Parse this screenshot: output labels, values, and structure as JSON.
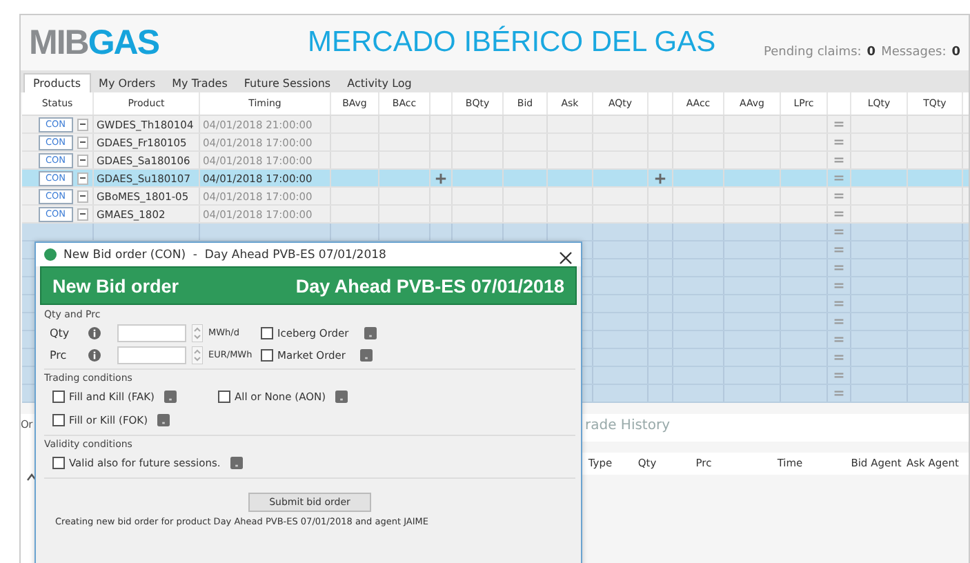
{
  "header": {
    "logo_left": "MIB",
    "logo_right": "GAS",
    "title": "MERCADO IBÉRICO DEL GAS",
    "pending_label": "Pending claims:",
    "pending_count": "0",
    "messages_label": "Messages:",
    "messages_count": "0"
  },
  "tabs": [
    {
      "label": "Products",
      "selected": true
    },
    {
      "label": "My Orders",
      "selected": false
    },
    {
      "label": "My Trades",
      "selected": false
    },
    {
      "label": "Future Sessions",
      "selected": false
    },
    {
      "label": "Activity Log",
      "selected": false
    }
  ],
  "table": {
    "columns": [
      {
        "kind": "text",
        "label": "Status"
      },
      {
        "kind": "text",
        "label": "Product"
      },
      {
        "kind": "text",
        "label": "Timing"
      },
      {
        "kind": "text",
        "label": "BAvg"
      },
      {
        "kind": "text",
        "label": "BAcc"
      },
      {
        "kind": "action"
      },
      {
        "kind": "text",
        "label": "BQty"
      },
      {
        "kind": "text",
        "label": "Bid"
      },
      {
        "kind": "text",
        "label": "Ask"
      },
      {
        "kind": "text",
        "label": "AQty"
      },
      {
        "kind": "action"
      },
      {
        "kind": "text",
        "label": "AAcc"
      },
      {
        "kind": "text",
        "label": "AAvg"
      },
      {
        "kind": "text",
        "label": "LPrc"
      },
      {
        "kind": "marker"
      },
      {
        "kind": "text",
        "label": "LQty"
      },
      {
        "kind": "text",
        "label": "TQty"
      }
    ],
    "rows": [
      {
        "kind": "product",
        "status": "CON",
        "product": "GWDES_Th180104",
        "timing": "04/01/2018 21:00:00",
        "selected": false
      },
      {
        "kind": "product",
        "status": "CON",
        "product": "GDAES_Fr180105",
        "timing": "04/01/2018 17:00:00",
        "selected": false
      },
      {
        "kind": "product",
        "status": "CON",
        "product": "GDAES_Sa180106",
        "timing": "04/01/2018 17:00:00",
        "selected": false
      },
      {
        "kind": "product",
        "status": "CON",
        "product": "GDAES_Su180107",
        "timing": "04/01/2018 17:00:00",
        "selected": true
      },
      {
        "kind": "product",
        "status": "CON",
        "product": "GBoMES_1801-05",
        "timing": "04/01/2018 17:00:00",
        "selected": false
      },
      {
        "kind": "product",
        "status": "CON",
        "product": "GMAES_1802",
        "timing": "04/01/2018 17:00:00",
        "selected": false
      },
      {
        "kind": "blank"
      },
      {
        "kind": "blank"
      },
      {
        "kind": "blank"
      },
      {
        "kind": "blank"
      },
      {
        "kind": "blank"
      },
      {
        "kind": "blank"
      },
      {
        "kind": "blank"
      },
      {
        "kind": "blank"
      },
      {
        "kind": "blank"
      },
      {
        "kind": "blank"
      }
    ]
  },
  "bottom": {
    "left_tab": "Or",
    "trade_history": "rade History",
    "trade_columns": [
      "Type",
      "Qty",
      "Prc",
      "Time",
      "Bid Agent",
      "Ask Agent"
    ]
  },
  "dialog": {
    "title": "New Bid order (CON)  -  Day Ahead PVB-ES 07/01/2018",
    "banner_left": "New Bid order",
    "banner_right": "Day Ahead PVB-ES 07/01/2018",
    "sections": [
      {
        "kind": "fields",
        "title": "Qty and Prc",
        "fields": [
          {
            "label": "Qty",
            "unit": "MWh/d",
            "option": {
              "label": "Iceberg Order",
              "checked": false
            }
          },
          {
            "label": "Prc",
            "unit": "EUR/MWh",
            "option": {
              "label": "Market Order",
              "checked": false
            }
          }
        ]
      },
      {
        "kind": "options",
        "title": "Trading conditions",
        "rows": [
          [
            {
              "label": "Fill and Kill (FAK)",
              "checked": false
            },
            {
              "label": "All or None (AON)",
              "checked": false
            }
          ],
          [
            {
              "label": "Fill or Kill (FOK)",
              "checked": false
            }
          ]
        ]
      },
      {
        "kind": "options",
        "title": "Validity conditions",
        "rows": [
          [
            {
              "label": "Valid also for future sessions.",
              "checked": false
            }
          ]
        ]
      }
    ],
    "submit": "Submit bid order",
    "status": "Creating new bid order for product Day Ahead PVB-ES 07/01/2018 and agent JAIME"
  }
}
